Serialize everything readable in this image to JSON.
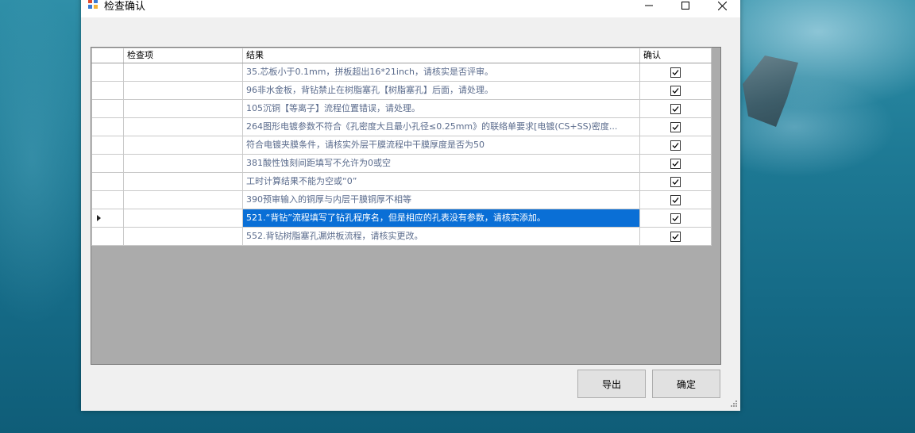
{
  "window": {
    "title": "检查确认",
    "controls": {
      "minimize": "—",
      "maximize": "☐",
      "close": "✕"
    }
  },
  "grid": {
    "columns": [
      "",
      "检查项",
      "结果",
      "确认"
    ],
    "selected_row": 8,
    "rows": [
      {
        "item": "",
        "result": "35.芯板小于0.1mm，拼板超出16*21inch，请核实是否评审。",
        "confirmed": true
      },
      {
        "item": "",
        "result": "96非水金板，背钻禁止在树脂塞孔【树脂塞孔】后面，请处理。",
        "confirmed": true
      },
      {
        "item": "",
        "result": "105沉铜【等离子】流程位置错误，请处理。",
        "confirmed": true
      },
      {
        "item": "",
        "result": "264图形电镀参数不符合《孔密度大且最小孔径≤0.25mm》的联络单要求[电镀(CS+SS)密度...",
        "confirmed": true
      },
      {
        "item": "",
        "result": "符合电镀夹膜条件，请核实外层干膜流程中干膜厚度是否为50",
        "confirmed": true
      },
      {
        "item": "",
        "result": "381酸性蚀刻间距填写不允许为0或空",
        "confirmed": true
      },
      {
        "item": "",
        "result": "工时计算结果不能为空或“0”",
        "confirmed": true
      },
      {
        "item": "",
        "result": "390预审输入的铜厚与内层干膜铜厚不相等",
        "confirmed": true
      },
      {
        "item": "",
        "result": "521.“背钻”流程填写了钻孔程序名，但是相应的孔表没有参数，请核实添加。",
        "confirmed": true
      },
      {
        "item": "",
        "result": "552.背钻树脂塞孔漏烘板流程，请核实更改。",
        "confirmed": true
      }
    ]
  },
  "buttons": {
    "export": "导出",
    "ok": "确定"
  },
  "colors": {
    "selection": "#0a6fd6",
    "result_text": "#5a6b8c"
  }
}
